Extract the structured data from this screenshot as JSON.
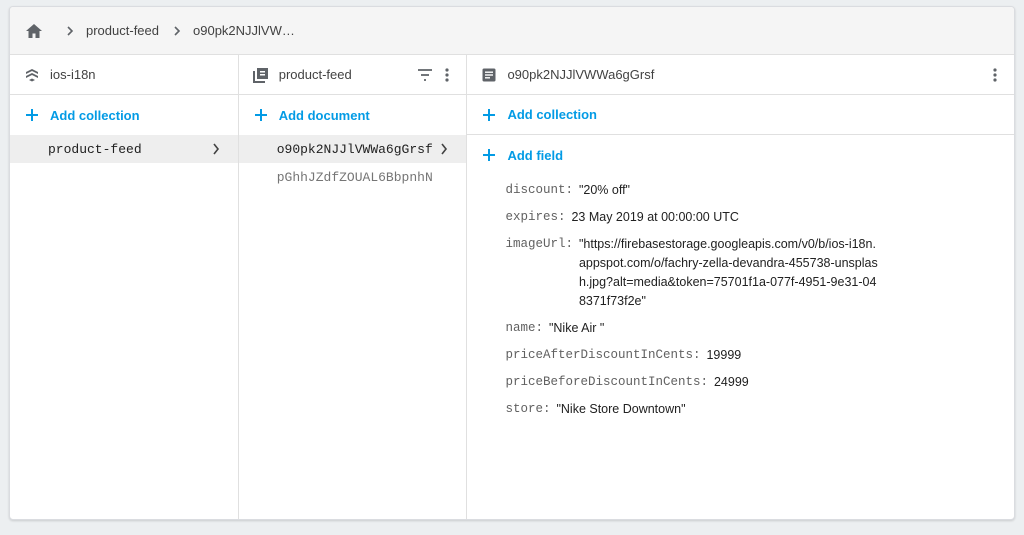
{
  "breadcrumb": {
    "items": [
      "product-feed",
      "o90pk2NJJlVW…"
    ]
  },
  "column1": {
    "title": "ios-i18n",
    "add_label": "Add collection",
    "items": [
      {
        "label": "product-feed",
        "selected": true
      }
    ]
  },
  "column2": {
    "title": "product-feed",
    "add_label": "Add document",
    "items": [
      {
        "label": "o90pk2NJJlVWWa6gGrsf",
        "selected": true
      },
      {
        "label": "pGhhJZdfZOUAL6BbpnhN",
        "selected": false
      }
    ]
  },
  "column3": {
    "title": "o90pk2NJJlVWWa6gGrsf",
    "add_collection_label": "Add collection",
    "add_field_label": "Add field",
    "fields": [
      {
        "key": "discount:",
        "value": "\"20% off\""
      },
      {
        "key": "expires:",
        "value": "23 May 2019 at 00:00:00 UTC"
      },
      {
        "key": "imageUrl:",
        "value": "\"https://firebasestorage.googleapis.com/v0/b/ios-i18n.appspot.com/o/fachry-zella-devandra-455738-unsplash.jpg?alt=media&token=75701f1a-077f-4951-9e31-048371f73f2e\""
      },
      {
        "key": "name:",
        "value": "\"Nike Air \""
      },
      {
        "key": "priceAfterDiscountInCents:",
        "value": "19999"
      },
      {
        "key": "priceBeforeDiscountInCents:",
        "value": "24999"
      },
      {
        "key": "store:",
        "value": "\"Nike Store Downtown\""
      }
    ]
  },
  "icons": {
    "home": "home-icon",
    "breadcrumb_separator": "chevron-right-icon",
    "project": "firestore-icon",
    "collection": "collection-icon",
    "document": "document-icon",
    "filter": "filter-icon",
    "more": "more-vert-icon",
    "add": "plus-icon",
    "chevron": "chevron-right-icon"
  },
  "colors": {
    "accent": "#039be5",
    "selected_bg": "#eeeeee",
    "border": "#e0e0e0"
  }
}
